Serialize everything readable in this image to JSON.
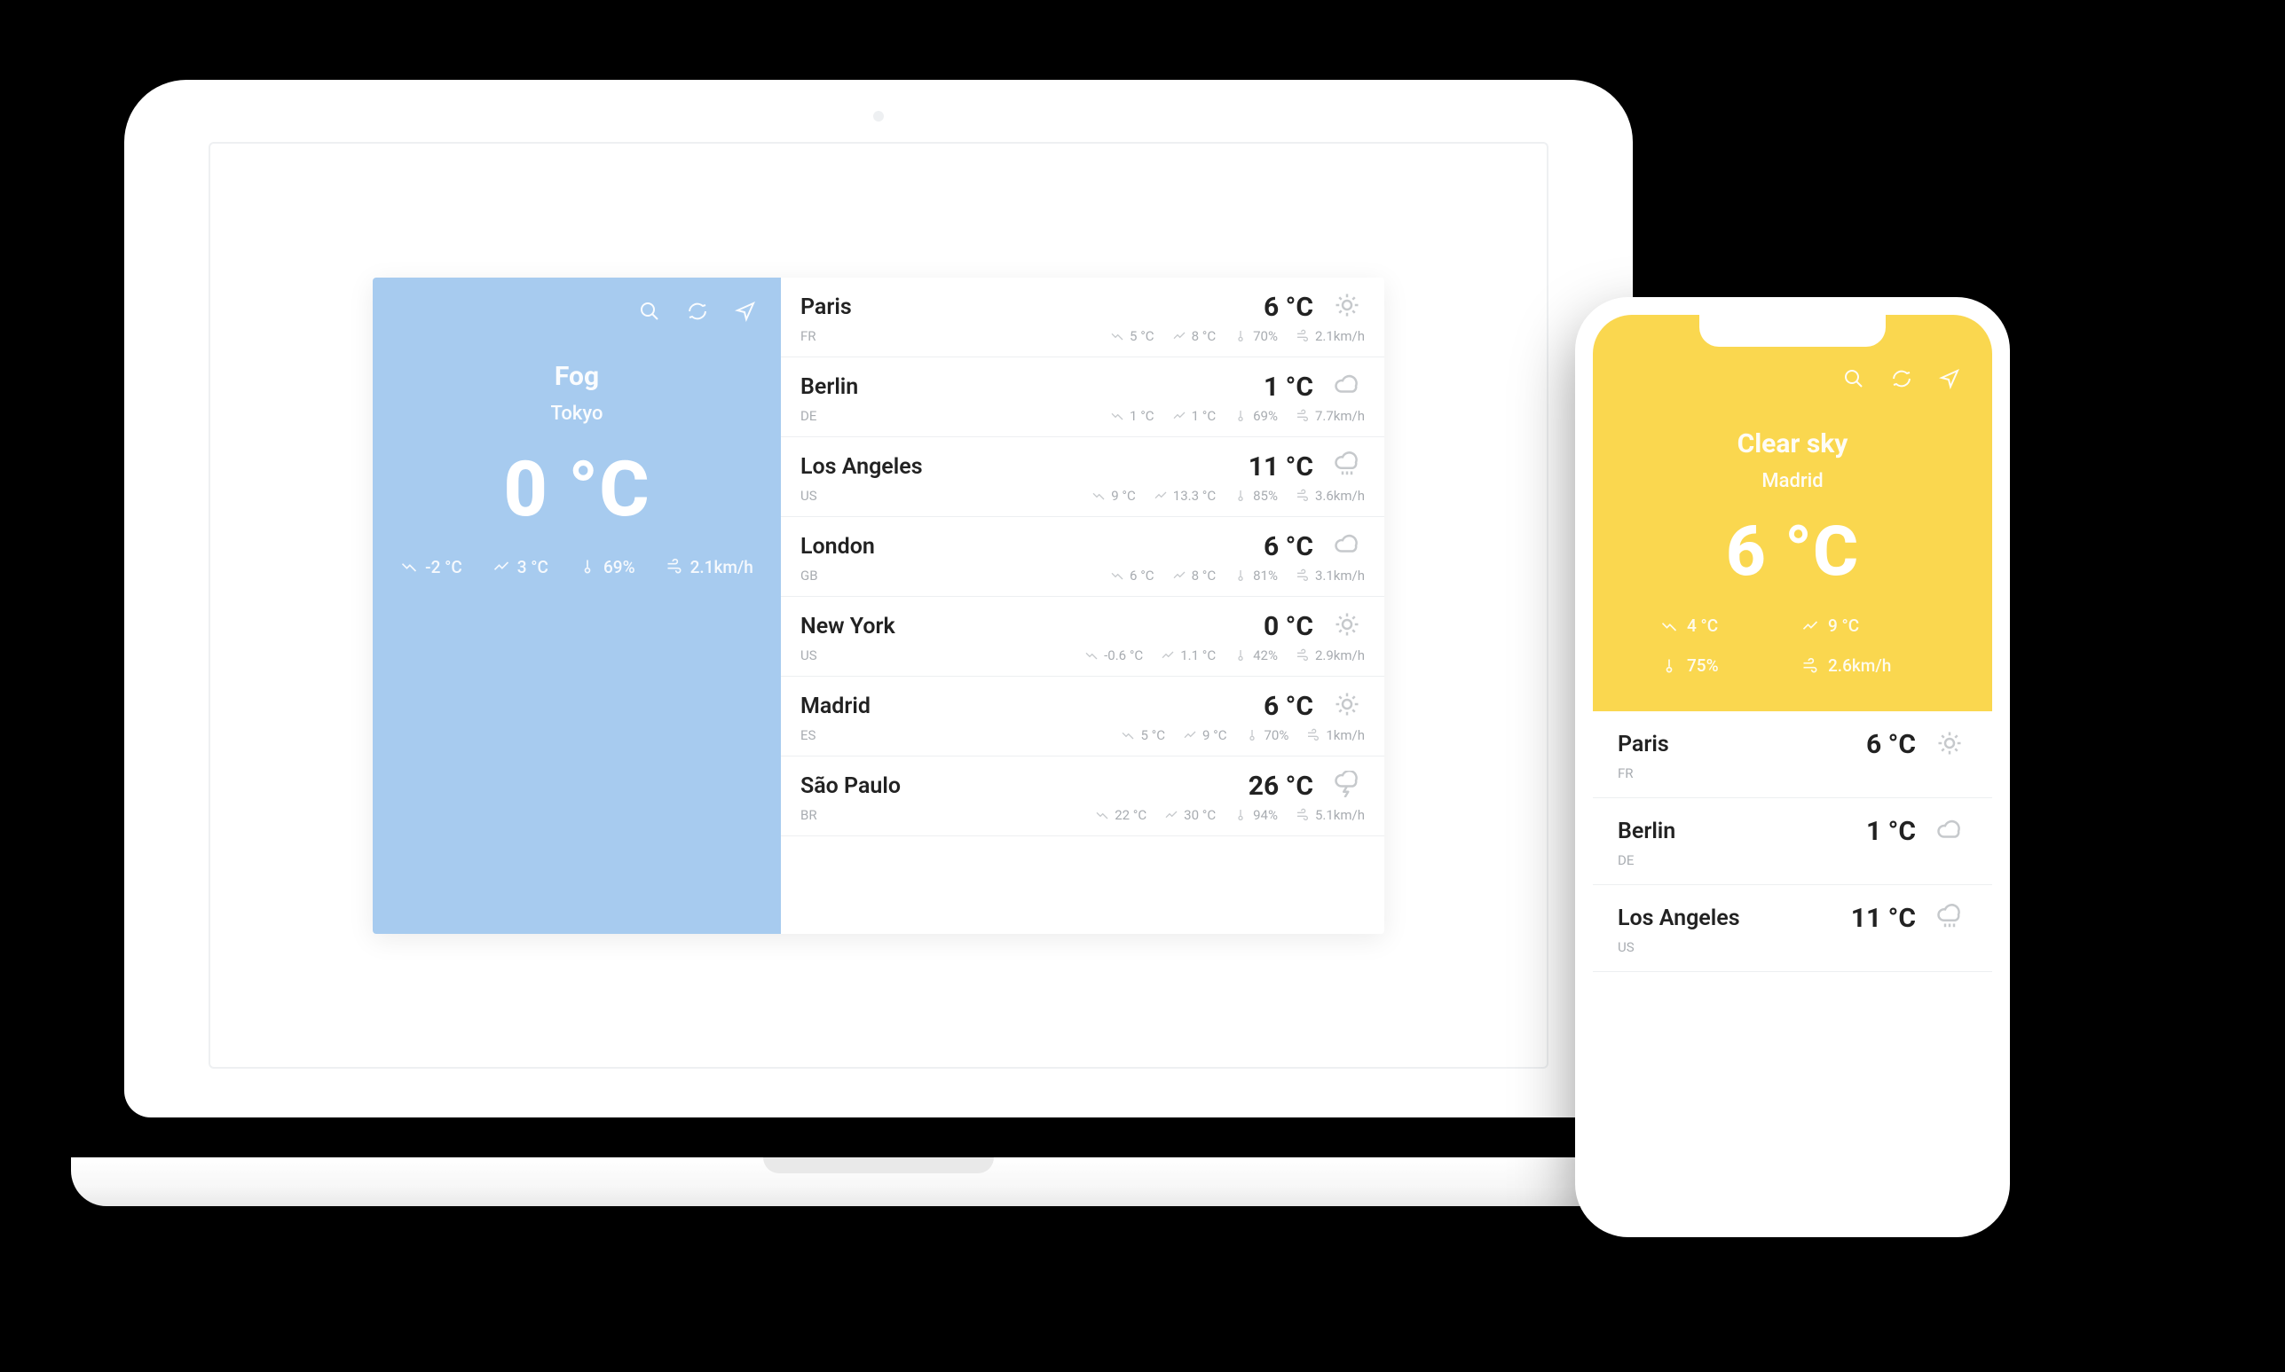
{
  "desktop": {
    "hero": {
      "condition": "Fog",
      "city": "Tokyo",
      "temp": "0 °C",
      "low": "-2 °C",
      "high": "3 °C",
      "humidity": "69%",
      "wind": "2.1km/h"
    },
    "cities": [
      {
        "name": "Paris",
        "cc": "FR",
        "temp": "6 °C",
        "wx": "sun",
        "low": "5 °C",
        "high": "8 °C",
        "hum": "70%",
        "wind": "2.1km/h"
      },
      {
        "name": "Berlin",
        "cc": "DE",
        "temp": "1 °C",
        "wx": "cloud",
        "low": "1 °C",
        "high": "1 °C",
        "hum": "69%",
        "wind": "7.7km/h"
      },
      {
        "name": "Los Angeles",
        "cc": "US",
        "temp": "11 °C",
        "wx": "rain",
        "low": "9 °C",
        "high": "13.3 °C",
        "hum": "85%",
        "wind": "3.6km/h"
      },
      {
        "name": "London",
        "cc": "GB",
        "temp": "6 °C",
        "wx": "cloud",
        "low": "6 °C",
        "high": "8 °C",
        "hum": "81%",
        "wind": "3.1km/h"
      },
      {
        "name": "New York",
        "cc": "US",
        "temp": "0 °C",
        "wx": "sun",
        "low": "-0.6 °C",
        "high": "1.1 °C",
        "hum": "42%",
        "wind": "2.9km/h"
      },
      {
        "name": "Madrid",
        "cc": "ES",
        "temp": "6 °C",
        "wx": "sun",
        "low": "5 °C",
        "high": "9 °C",
        "hum": "70%",
        "wind": "1km/h"
      },
      {
        "name": "São Paulo",
        "cc": "BR",
        "temp": "26 °C",
        "wx": "storm",
        "low": "22 °C",
        "high": "30 °C",
        "hum": "94%",
        "wind": "5.1km/h"
      }
    ]
  },
  "mobile": {
    "hero": {
      "condition": "Clear sky",
      "city": "Madrid",
      "temp": "6 °C",
      "low": "4 °C",
      "high": "9 °C",
      "humidity": "75%",
      "wind": "2.6km/h"
    },
    "cities": [
      {
        "name": "Paris",
        "cc": "FR",
        "temp": "6 °C",
        "wx": "sun"
      },
      {
        "name": "Berlin",
        "cc": "DE",
        "temp": "1 °C",
        "wx": "cloud"
      },
      {
        "name": "Los Angeles",
        "cc": "US",
        "temp": "11 °C",
        "wx": "rain"
      }
    ]
  }
}
